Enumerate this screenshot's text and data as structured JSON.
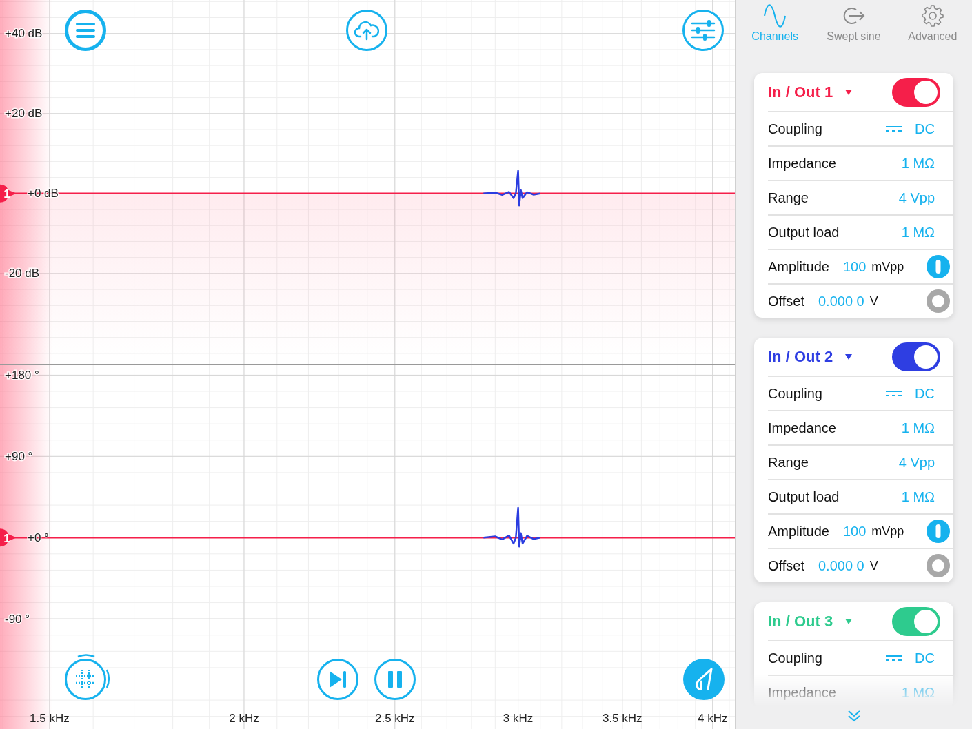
{
  "plots": [
    {
      "marker": {
        "label": "1"
      },
      "y_labels": [
        "+40 dB",
        "+20 dB",
        "+0 dB",
        "-20 dB"
      ]
    },
    {
      "marker": {
        "label": "1"
      },
      "y_labels": [
        "+180 °",
        "+90 °",
        "+0 °",
        "-90 °"
      ],
      "x_labels": [
        "1.5 kHz",
        "2 kHz",
        "2.5 kHz",
        "3 kHz",
        "3.5 kHz",
        "4 kHz"
      ]
    }
  ],
  "sidebar": {
    "tabs": [
      {
        "kind": "wave",
        "label": "Channels",
        "selected": true
      },
      {
        "kind": "export",
        "label": "Swept sine",
        "selected": false
      },
      {
        "kind": "gear",
        "label": "Advanced",
        "selected": false
      }
    ],
    "channels": [
      {
        "title": "In / Out 1",
        "color": "#f51f4a",
        "on": true,
        "rows": [
          {
            "kind": "coupling",
            "label": "Coupling",
            "value": "DC"
          },
          {
            "kind": "plain",
            "label": "Impedance",
            "value": "1 MΩ"
          },
          {
            "kind": "plain",
            "label": "Range",
            "value": "4 Vpp"
          },
          {
            "kind": "plain",
            "label": "Output load",
            "value": "1 MΩ"
          },
          {
            "kind": "dial",
            "label": "Amplitude",
            "value": "100",
            "unit": "mVpp"
          },
          {
            "kind": "ring",
            "label": "Offset",
            "value": "0.000 0",
            "unit": "V"
          }
        ]
      },
      {
        "title": "In / Out 2",
        "color": "#2e3ee2",
        "on": true,
        "rows": [
          {
            "kind": "coupling",
            "label": "Coupling",
            "value": "DC"
          },
          {
            "kind": "plain",
            "label": "Impedance",
            "value": "1 MΩ"
          },
          {
            "kind": "plain",
            "label": "Range",
            "value": "4 Vpp"
          },
          {
            "kind": "plain",
            "label": "Output load",
            "value": "1 MΩ"
          },
          {
            "kind": "dial",
            "label": "Amplitude",
            "value": "100",
            "unit": "mVpp"
          },
          {
            "kind": "ring",
            "label": "Offset",
            "value": "0.000 0",
            "unit": "V"
          }
        ]
      },
      {
        "title": "In / Out 3",
        "color": "#2ecb8e",
        "on": true,
        "rows": [
          {
            "kind": "coupling",
            "label": "Coupling",
            "value": "DC"
          },
          {
            "kind": "plain",
            "label": "Impedance",
            "value": "1 MΩ"
          }
        ]
      }
    ]
  }
}
